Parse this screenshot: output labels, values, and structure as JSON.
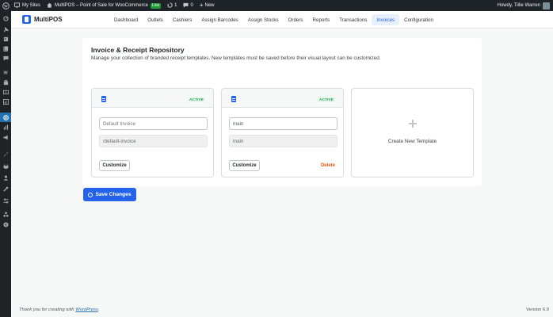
{
  "admin_bar": {
    "my_sites": "My Sites",
    "site_name": "MultiPOS – Point of Sale for WooCommerce",
    "live_badge": "Live",
    "updates_count": "1",
    "comments_count": "0",
    "new_label": "New",
    "greeting": "Howdy, Tillie Warren"
  },
  "app": {
    "brand": "MultiPOS",
    "accent": "#2563eb",
    "nav_tabs": [
      "Dashboard",
      "Outlets",
      "Cashiers",
      "Assign Barcodes",
      "Assign Stocks",
      "Orders",
      "Reports",
      "Transactions",
      "Invoices",
      "Configuration"
    ],
    "active_tab": "Invoices"
  },
  "repository": {
    "title": "Invoice & Receipt Repository",
    "description": "Manage your collection of branded receipt templates. New templates must be saved before their visual layout can be customized.",
    "templates": [
      {
        "status": "ACTIVE",
        "name_placeholder": "Default Invoice",
        "slug": "/default-invoice",
        "customize_label": "Customize",
        "delete_label": ""
      },
      {
        "status": "ACTIVE",
        "name_value": "main",
        "slug": "main",
        "customize_label": "Customize",
        "delete_label": "Delete"
      }
    ],
    "create_new_label": "Create New Template",
    "save_label": "Save Changes"
  },
  "footer": {
    "thanks_prefix": "Thank you for creating with ",
    "thanks_link": "WordPress",
    "thanks_suffix": ".",
    "version": "Version 6.9"
  }
}
